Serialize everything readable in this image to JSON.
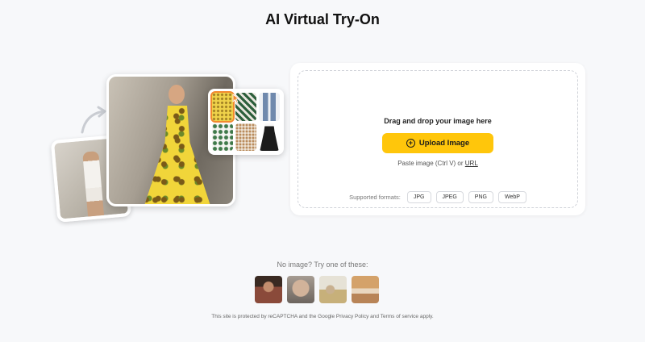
{
  "page": {
    "title": "AI Virtual Try-On"
  },
  "upload": {
    "drag_text": "Drag and drop your image here",
    "button_label": "Upload Image",
    "paste_text": "Paste image (Ctrl V) or",
    "url_link": "URL",
    "formats_label": "Supported formats:",
    "formats": [
      "JPG",
      "JPEG",
      "PNG",
      "WebP"
    ]
  },
  "samples": {
    "title": "No image? Try one of these:",
    "items": [
      "sample-woman",
      "sample-dog",
      "sample-beach",
      "sample-car"
    ]
  },
  "footer": {
    "text": "This site is protected by reCAPTCHA and the Google Privacy Policy and Terms of service apply."
  },
  "colors": {
    "accent": "#ffc60b",
    "background": "#f7f8fa",
    "card": "#ffffff"
  },
  "icons": {
    "upload": "plus-circle-icon",
    "arrow": "curved-arrow-icon",
    "cursor": "pointer-cursor-icon"
  }
}
